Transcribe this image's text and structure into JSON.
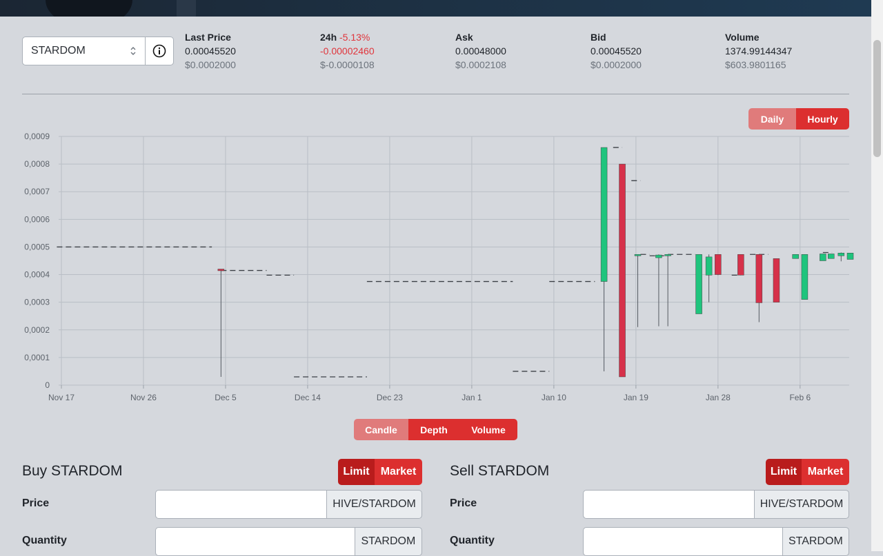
{
  "colors": {
    "accent": "#dc2f2f",
    "up": "#1fc47d",
    "down": "#d6314a",
    "negative": "#e0353c"
  },
  "selector": {
    "value": "STARDOM",
    "chevron_icon": "chevron-updown-icon",
    "info_icon": "info-circle-icon"
  },
  "stats": {
    "last_price": {
      "label": "Last Price",
      "value": "0.00045520",
      "usd": "$0.0002000"
    },
    "change_24h": {
      "label": "24h",
      "pct": "-5.13%",
      "value": "-0.00002460",
      "usd": "$-0.0000108"
    },
    "ask": {
      "label": "Ask",
      "value": "0.00048000",
      "usd": "$0.0002108"
    },
    "bid": {
      "label": "Bid",
      "value": "0.00045520",
      "usd": "$0.0002000"
    },
    "volume": {
      "label": "Volume",
      "value": "1374.99144347",
      "usd": "$603.9801165"
    }
  },
  "interval_toggle": {
    "daily": "Daily",
    "hourly": "Hourly",
    "active": "Hourly"
  },
  "chart_tabs": {
    "candle": "Candle",
    "depth": "Depth",
    "volume": "Volume",
    "active": "Candle"
  },
  "chart_data": {
    "type": "candlestick",
    "ylim": [
      0,
      0.0009
    ],
    "y_ticks": [
      "0",
      "0,0001",
      "0,0002",
      "0,0003",
      "0,0004",
      "0,0005",
      "0,0006",
      "0,0007",
      "0,0008",
      "0,0009"
    ],
    "x_ticks": [
      "Nov 17",
      "Nov 26",
      "Dec 5",
      "Dec 14",
      "Dec 23",
      "Jan 1",
      "Jan 10",
      "Jan 19",
      "Jan 28",
      "Feb 6"
    ],
    "x_tick_days": [
      0,
      9,
      18,
      27,
      36,
      45,
      54,
      63,
      72,
      81
    ],
    "x_range_days": [
      0,
      86
    ],
    "flat_segments": [
      {
        "start": -0.5,
        "end": 16.5,
        "price": 0.0005
      },
      {
        "start": 17.5,
        "end": 22.5,
        "price": 0.000415
      },
      {
        "start": 22.5,
        "end": 25.5,
        "price": 0.000398
      },
      {
        "start": 25.5,
        "end": 33.5,
        "price": 3e-05
      },
      {
        "start": 33.5,
        "end": 49.5,
        "price": 0.000375
      },
      {
        "start": 49.5,
        "end": 53.5,
        "price": 5e-05
      },
      {
        "start": 53.5,
        "end": 58.5,
        "price": 0.000375
      },
      {
        "start": 60.5,
        "end": 61.5,
        "price": 0.00086
      },
      {
        "start": 62.5,
        "end": 63.5,
        "price": 0.00074
      },
      {
        "start": 63.5,
        "end": 64.5,
        "price": 0.000473
      },
      {
        "start": 64.5,
        "end": 66.5,
        "price": 0.000468
      },
      {
        "start": 66.5,
        "end": 67.5,
        "price": 0.000473
      },
      {
        "start": 67.5,
        "end": 68.5,
        "price": 0.000473
      },
      {
        "start": 68.5,
        "end": 69.5,
        "price": 0.000473
      },
      {
        "start": 73.5,
        "end": 74.5,
        "price": 0.000398
      },
      {
        "start": 75.5,
        "end": 77.5,
        "price": 0.000473
      },
      {
        "start": 83.5,
        "end": 84.5,
        "price": 0.00048
      }
    ],
    "candles": [
      {
        "day": 17.5,
        "open": 0.00042,
        "close": 0.000414,
        "high": 0.00042,
        "low": 3e-05
      },
      {
        "day": 59.5,
        "open": 0.000375,
        "close": 0.00086,
        "high": 0.00086,
        "low": 5e-05
      },
      {
        "day": 61.5,
        "open": 0.0008,
        "close": 3e-05,
        "high": 0.0008,
        "low": 3e-05
      },
      {
        "day": 63.2,
        "open": 0.000473,
        "close": 0.000473,
        "high": 0.000473,
        "low": 0.00021
      },
      {
        "day": 65.5,
        "open": 0.000461,
        "close": 0.000471,
        "high": 0.000473,
        "low": 0.000213
      },
      {
        "day": 66.5,
        "open": 0.000473,
        "close": 0.000473,
        "high": 0.000473,
        "low": 0.000213
      },
      {
        "day": 69.9,
        "open": 0.000258,
        "close": 0.000473,
        "high": 0.000473,
        "low": 0.000258
      },
      {
        "day": 71.0,
        "open": 0.000398,
        "close": 0.000464,
        "high": 0.000473,
        "low": 0.0003
      },
      {
        "day": 72.0,
        "open": 0.000473,
        "close": 0.0004,
        "high": 0.000473,
        "low": 0.000398
      },
      {
        "day": 74.5,
        "open": 0.000473,
        "close": 0.000398,
        "high": 0.000473,
        "low": 0.000398
      },
      {
        "day": 76.5,
        "open": 0.000473,
        "close": 0.000298,
        "high": 0.000473,
        "low": 0.000228
      },
      {
        "day": 78.4,
        "open": 0.000458,
        "close": 0.0003,
        "high": 0.000458,
        "low": 0.0003
      },
      {
        "day": 80.5,
        "open": 0.000458,
        "close": 0.000473,
        "high": 0.000473,
        "low": 0.000458
      },
      {
        "day": 81.5,
        "open": 0.00031,
        "close": 0.000473,
        "high": 0.000473,
        "low": 0.00031
      },
      {
        "day": 83.5,
        "open": 0.00045,
        "close": 0.000475,
        "high": 0.000475,
        "low": 0.00045
      },
      {
        "day": 84.4,
        "open": 0.000458,
        "close": 0.000475,
        "high": 0.000475,
        "low": 0.000458
      },
      {
        "day": 85.5,
        "open": 0.000468,
        "close": 0.000478,
        "high": 0.00048,
        "low": 0.000448
      },
      {
        "day": 86.5,
        "open": 0.000455,
        "close": 0.000478,
        "high": 0.000478,
        "low": 0.000455
      }
    ]
  },
  "buy": {
    "title": "Buy STARDOM",
    "limit": "Limit",
    "market": "Market",
    "price_label": "Price",
    "price_unit": "HIVE/STARDOM",
    "price_value": "",
    "quantity_label": "Quantity",
    "quantity_unit": "STARDOM",
    "quantity_value": ""
  },
  "sell": {
    "title": "Sell STARDOM",
    "limit": "Limit",
    "market": "Market",
    "price_label": "Price",
    "price_unit": "HIVE/STARDOM",
    "price_value": "",
    "quantity_label": "Quantity",
    "quantity_unit": "STARDOM",
    "quantity_value": ""
  }
}
